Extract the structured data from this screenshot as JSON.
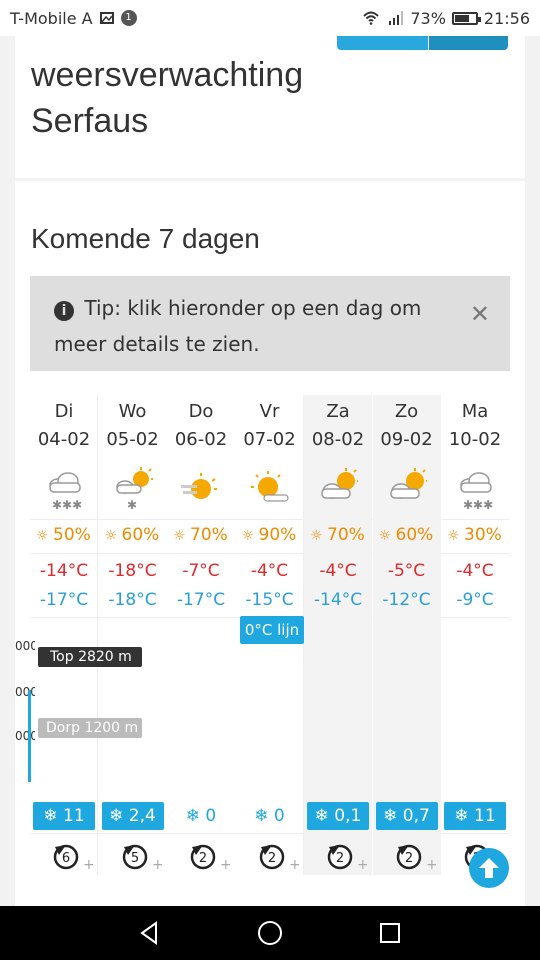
{
  "status_bar": {
    "carrier": "T-Mobile A",
    "battery": "73%",
    "battery_level": 0.73,
    "time": "21:56"
  },
  "header": {
    "title": "weersverwachting Serfaus"
  },
  "forecast": {
    "heading": "Komende 7 dagen",
    "tip": {
      "label": "Tip:",
      "text": "klik hieronder op een dag om meer details te zien."
    },
    "days": [
      {
        "day": "Di",
        "date": "04-02",
        "icon": "cloud-snow-icon",
        "sun": "50%",
        "tmax": "-14°C",
        "tmin": "-17°C",
        "snow": "11",
        "wind": "6"
      },
      {
        "day": "Wo",
        "date": "05-02",
        "icon": "sun-cloud-snow-icon",
        "sun": "60%",
        "tmax": "-18°C",
        "tmin": "-18°C",
        "snow": "2,4",
        "wind": "5"
      },
      {
        "day": "Do",
        "date": "06-02",
        "icon": "sun-haze-icon",
        "sun": "70%",
        "tmax": "-7°C",
        "tmin": "-17°C",
        "snow": "0",
        "wind": "2"
      },
      {
        "day": "Vr",
        "date": "07-02",
        "icon": "sun-icon",
        "sun": "90%",
        "tmax": "-4°C",
        "tmin": "-15°C",
        "snow": "0",
        "wind": "2"
      },
      {
        "day": "Za",
        "date": "08-02",
        "icon": "sun-cloud-icon",
        "sun": "70%",
        "tmax": "-4°C",
        "tmin": "-14°C",
        "snow": "0,1",
        "wind": "2"
      },
      {
        "day": "Zo",
        "date": "09-02",
        "icon": "sun-cloud-icon",
        "sun": "60%",
        "tmax": "-5°C",
        "tmin": "-12°C",
        "snow": "0,7",
        "wind": "2"
      },
      {
        "day": "Ma",
        "date": "10-02",
        "icon": "cloud-snow-icon",
        "sun": "30%",
        "tmax": "-4°C",
        "tmin": "-9°C",
        "snow": "11",
        "wind": "2"
      }
    ],
    "zero_line": "0°C lijn",
    "top_label": "Top 2820 m",
    "dorp_label": "Dorp 1200 m",
    "axis_labels": [
      "000",
      "000",
      "000"
    ]
  },
  "colors": {
    "accent": "#1ea8df",
    "max_temp": "#e0282d",
    "min_temp": "#2a9fd6",
    "sun": "#f08a00"
  }
}
